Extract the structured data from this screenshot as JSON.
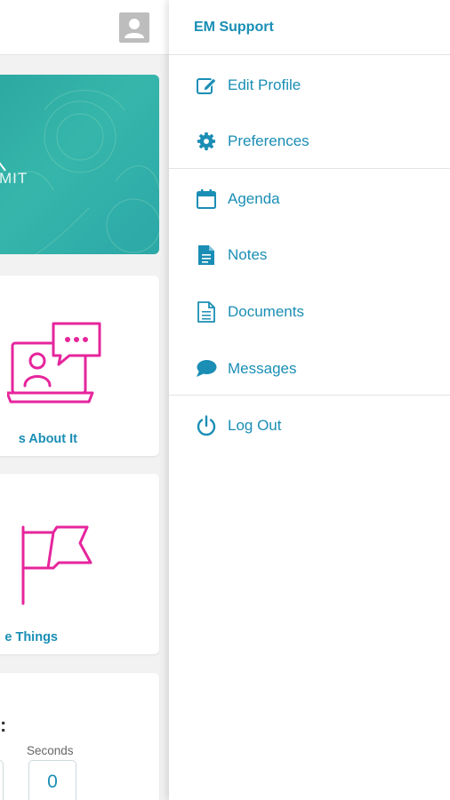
{
  "background": {
    "hero_text": "MIT",
    "cards": [
      {
        "caption": "s About It"
      },
      {
        "caption": "e Things"
      }
    ],
    "countdown": {
      "label": "Seconds",
      "value": "0",
      "colon": ":"
    }
  },
  "drawer": {
    "title": "EM Support",
    "items": [
      {
        "label": "Edit Profile",
        "icon": "edit-icon"
      },
      {
        "label": "Preferences",
        "icon": "gear-icon"
      },
      {
        "label": "Agenda",
        "icon": "calendar-icon"
      },
      {
        "label": "Notes",
        "icon": "note-icon"
      },
      {
        "label": "Documents",
        "icon": "document-icon"
      },
      {
        "label": "Messages",
        "icon": "chat-bubble-icon"
      },
      {
        "label": "Log Out",
        "icon": "power-icon"
      }
    ]
  },
  "colors": {
    "accent": "#1a8eb5",
    "magenta": "#e6259c",
    "teal": "#2ca8a8"
  }
}
